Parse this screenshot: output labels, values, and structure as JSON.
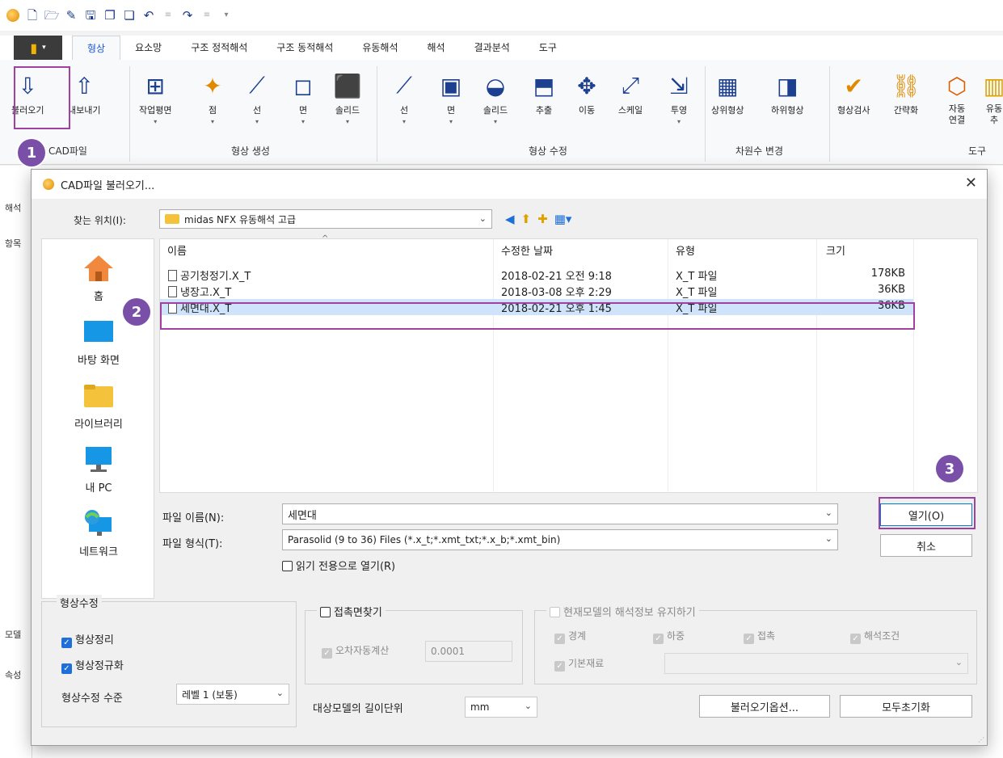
{
  "ribbon": {
    "tabs": [
      "형상",
      "요소망",
      "구조 정적해석",
      "구조 동적해석",
      "유동해석",
      "해석",
      "결과분석",
      "도구"
    ],
    "active_tab": "형상",
    "groups": [
      {
        "label": "CAD파일",
        "buttons": [
          "불러오기",
          "내보내기"
        ]
      },
      {
        "label": "형상 생성",
        "buttons": [
          "작업평면",
          "점",
          "선",
          "면",
          "솔리드"
        ]
      },
      {
        "label": "형상 수정",
        "buttons": [
          "선",
          "면",
          "솔리드",
          "추출",
          "이동",
          "스케일",
          "투영"
        ]
      },
      {
        "label": "차원수 변경",
        "buttons": [
          "상위형상",
          "하위형상"
        ]
      },
      {
        "label": "도구",
        "buttons": [
          "형상검사",
          "간략화",
          "자동\n연결",
          "유동\n추"
        ]
      }
    ]
  },
  "left_panel": {
    "items": [
      "해석",
      "항목",
      "모델",
      "속성"
    ]
  },
  "badges": [
    "1",
    "2",
    "3"
  ],
  "dialog": {
    "title": "CAD파일 불러오기...",
    "look_in_label": "찾는 위치(I):",
    "look_in_value": "midas NFX 유동해석 고급",
    "places": [
      "홈",
      "바탕 화면",
      "라이브러리",
      "내 PC",
      "네트워크"
    ],
    "columns": [
      "이름",
      "수정한 날짜",
      "유형",
      "크기"
    ],
    "files": [
      {
        "name": "공기청정기.X_T",
        "date": "2018-02-21 오전 9:18",
        "type": "X_T 파일",
        "size": "178KB"
      },
      {
        "name": "냉장고.X_T",
        "date": "2018-03-08 오후 2:29",
        "type": "X_T 파일",
        "size": "36KB"
      },
      {
        "name": "세면대.X_T",
        "date": "2018-02-21 오후 1:45",
        "type": "X_T 파일",
        "size": "36KB"
      }
    ],
    "filename_label": "파일 이름(N):",
    "filename_value": "세면대",
    "filetype_label": "파일 형식(T):",
    "filetype_value": "Parasolid (9 to 36) Files (*.x_t;*.xmt_txt;*.x_b;*.xmt_bin)",
    "readonly_label": "읽기 전용으로 열기(R)",
    "open_label": "열기(O)",
    "cancel_label": "취소",
    "shape_fix": {
      "legend": "형상수정",
      "opt1": "형상정리",
      "opt2": "형상정규화",
      "level_label": "형상수정 수준",
      "level_value": "레벨 1 (보통)"
    },
    "contact": {
      "legend": "접촉면찾기",
      "auto_label": "오차자동계산",
      "tolerance": "0.0001"
    },
    "unit_label": "대상모델의 길이단위",
    "unit_value": "mm",
    "keep_info": {
      "legend": "현재모델의 해석정보 유지하기",
      "items": [
        "경계",
        "하중",
        "접촉",
        "해석조건",
        "기본재료"
      ]
    },
    "import_options_label": "불러오기옵션...",
    "reset_label": "모두초기화"
  }
}
